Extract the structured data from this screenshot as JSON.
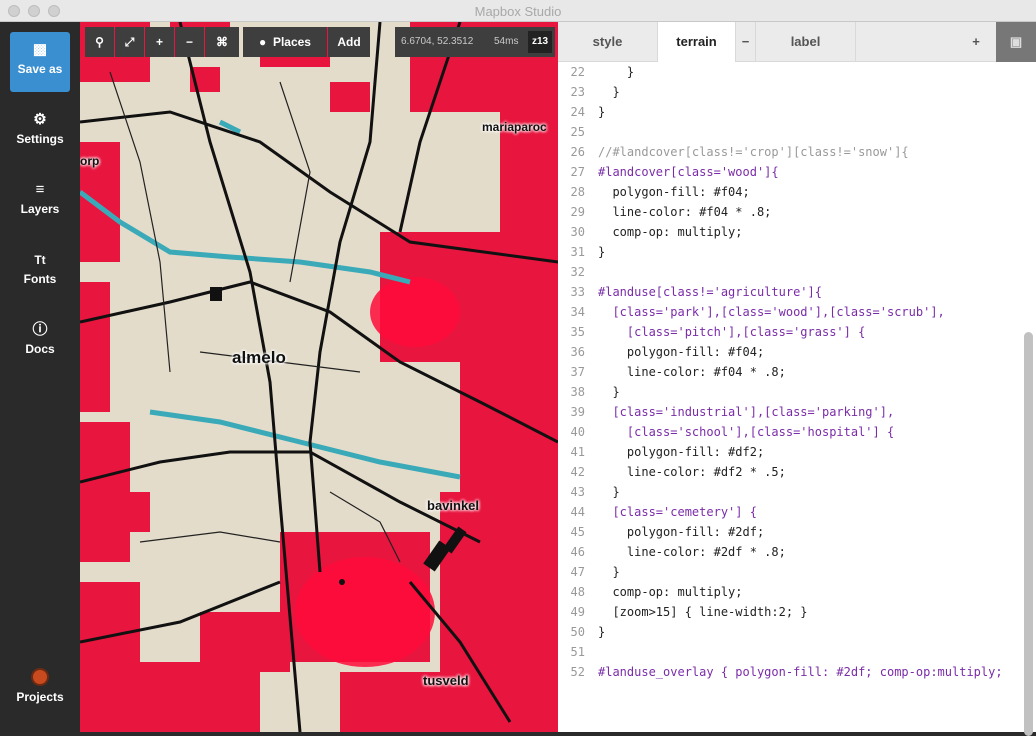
{
  "window": {
    "title": "Mapbox Studio"
  },
  "sidebar": {
    "items": [
      {
        "label": "Save as",
        "icon": "save-icon"
      },
      {
        "label": "Settings",
        "icon": "gear-icon"
      },
      {
        "label": "Layers",
        "icon": "layers-icon"
      },
      {
        "label": "Fonts",
        "icon": "fonts-icon"
      },
      {
        "label": "Docs",
        "icon": "info-icon"
      },
      {
        "label": "Projects",
        "icon": "projects-icon"
      }
    ]
  },
  "map_toolbar": {
    "places_label": "Places",
    "add_label": "Add",
    "coordinates": "6.6704, 52.3512",
    "render_time": "54ms",
    "zoom": "z13"
  },
  "map_labels": [
    "mariaparoc",
    "orp",
    "almelo",
    "bavinkel",
    "tusveld"
  ],
  "tabs": [
    {
      "label": "style"
    },
    {
      "label": "terrain"
    },
    {
      "label": "−"
    },
    {
      "label": "label"
    },
    {
      "label": "+"
    }
  ],
  "colors": {
    "f04": "#ff0044",
    "df2": "#ddff22",
    "2df": "#22ddff",
    "accent": "#3a8fd1"
  },
  "code": {
    "lines": [
      {
        "n": "22",
        "text": "    }"
      },
      {
        "n": "23",
        "text": "  }"
      },
      {
        "n": "24",
        "text": "}"
      },
      {
        "n": "25",
        "text": ""
      },
      {
        "n": "26",
        "text": "//#landcover[class!='crop'][class!='snow']{"
      },
      {
        "n": "27",
        "text": "#landcover[class='wood']{"
      },
      {
        "n": "28",
        "text": "  polygon-fill: #f04;"
      },
      {
        "n": "29",
        "text": "  line-color: #f04 * .8;"
      },
      {
        "n": "30",
        "text": "  comp-op: multiply;"
      },
      {
        "n": "31",
        "text": "}"
      },
      {
        "n": "32",
        "text": ""
      },
      {
        "n": "33",
        "text": "#landuse[class!='agriculture']{"
      },
      {
        "n": "34",
        "text": "  [class='park'],[class='wood'],[class='scrub'],"
      },
      {
        "n": "35",
        "text": "    [class='pitch'],[class='grass'] {"
      },
      {
        "n": "36",
        "text": "    polygon-fill: #f04;"
      },
      {
        "n": "37",
        "text": "    line-color: #f04 * .8;"
      },
      {
        "n": "38",
        "text": "  }"
      },
      {
        "n": "39",
        "text": "  [class='industrial'],[class='parking'],"
      },
      {
        "n": "40",
        "text": "    [class='school'],[class='hospital'] {"
      },
      {
        "n": "41",
        "text": "    polygon-fill: #df2;"
      },
      {
        "n": "42",
        "text": "    line-color: #df2 * .5;"
      },
      {
        "n": "43",
        "text": "  }"
      },
      {
        "n": "44",
        "text": "  [class='cemetery'] {"
      },
      {
        "n": "45",
        "text": "    polygon-fill: #2df;"
      },
      {
        "n": "46",
        "text": "    line-color: #2df * .8;"
      },
      {
        "n": "47",
        "text": "  }"
      },
      {
        "n": "48",
        "text": "  comp-op: multiply;"
      },
      {
        "n": "49",
        "text": "  [zoom>15] { line-width:2; }"
      },
      {
        "n": "50",
        "text": "}"
      },
      {
        "n": "51",
        "text": ""
      },
      {
        "n": "52",
        "text": "#landuse_overlay { polygon-fill: #2df; comp-op:multiply;"
      }
    ]
  }
}
